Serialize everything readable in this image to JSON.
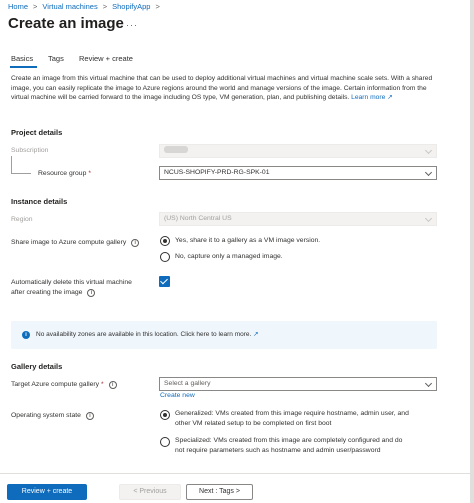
{
  "breadcrumb": {
    "items": [
      "Home",
      "Virtual machines",
      "ShopifyApp"
    ],
    "separator": ">"
  },
  "page": {
    "title": "Create an image",
    "more": "···"
  },
  "tabs": [
    {
      "label": "Basics",
      "active": true
    },
    {
      "label": "Tags"
    },
    {
      "label": "Review + create"
    }
  ],
  "description": {
    "text": "Create an image from this virtual machine that can be used to deploy additional virtual machines and virtual machine scale sets. With a shared image, you can easily replicate the image to Azure regions around the world and manage versions of the image. Certain information from the virtual machine will be carried forward to the image including OS type, VM generation, plan, and publishing details.",
    "learn_more": "Learn more"
  },
  "project_details": {
    "heading": "Project details",
    "subscription_label": "Subscription",
    "resource_group_label": "Resource group",
    "resource_group_value": "NCUS-SHOPIFY-PRD-RG-SPK-01"
  },
  "instance_details": {
    "heading": "Instance details",
    "region_label": "Region",
    "region_value": "(US) North Central US",
    "share_label": "Share image to Azure compute gallery",
    "share_option_yes": "Yes, share it to a gallery as a VM image version.",
    "share_option_no": "No, capture only a managed image.",
    "autodelete_label_1": "Automatically delete this virtual machine",
    "autodelete_label_2": "after creating the image",
    "autodelete_checked": true
  },
  "banner": {
    "icon": "info-icon",
    "text": "No availability zones are available in this location. Click here to learn more."
  },
  "gallery_details": {
    "heading": "Gallery details",
    "target_label": "Target Azure compute gallery",
    "target_placeholder": "Select a gallery",
    "create_new": "Create new",
    "os_state_label": "Operating system state",
    "os_option_generalized_1": "Generalized: VMs created from this image require hostname, admin user, and",
    "os_option_generalized_2": "other VM related setup to be completed on first boot",
    "os_option_specialized_1": "Specialized: VMs created from this image are completely configured and do",
    "os_option_specialized_2": "not require parameters such as hostname and admin user/password"
  },
  "footer": {
    "review_create": "Review + create",
    "previous": "< Previous",
    "next": "Next : Tags >"
  },
  "colors": {
    "accent": "#0f6cbd",
    "banner_bg": "#eff6fc",
    "required": "#a4262c"
  }
}
